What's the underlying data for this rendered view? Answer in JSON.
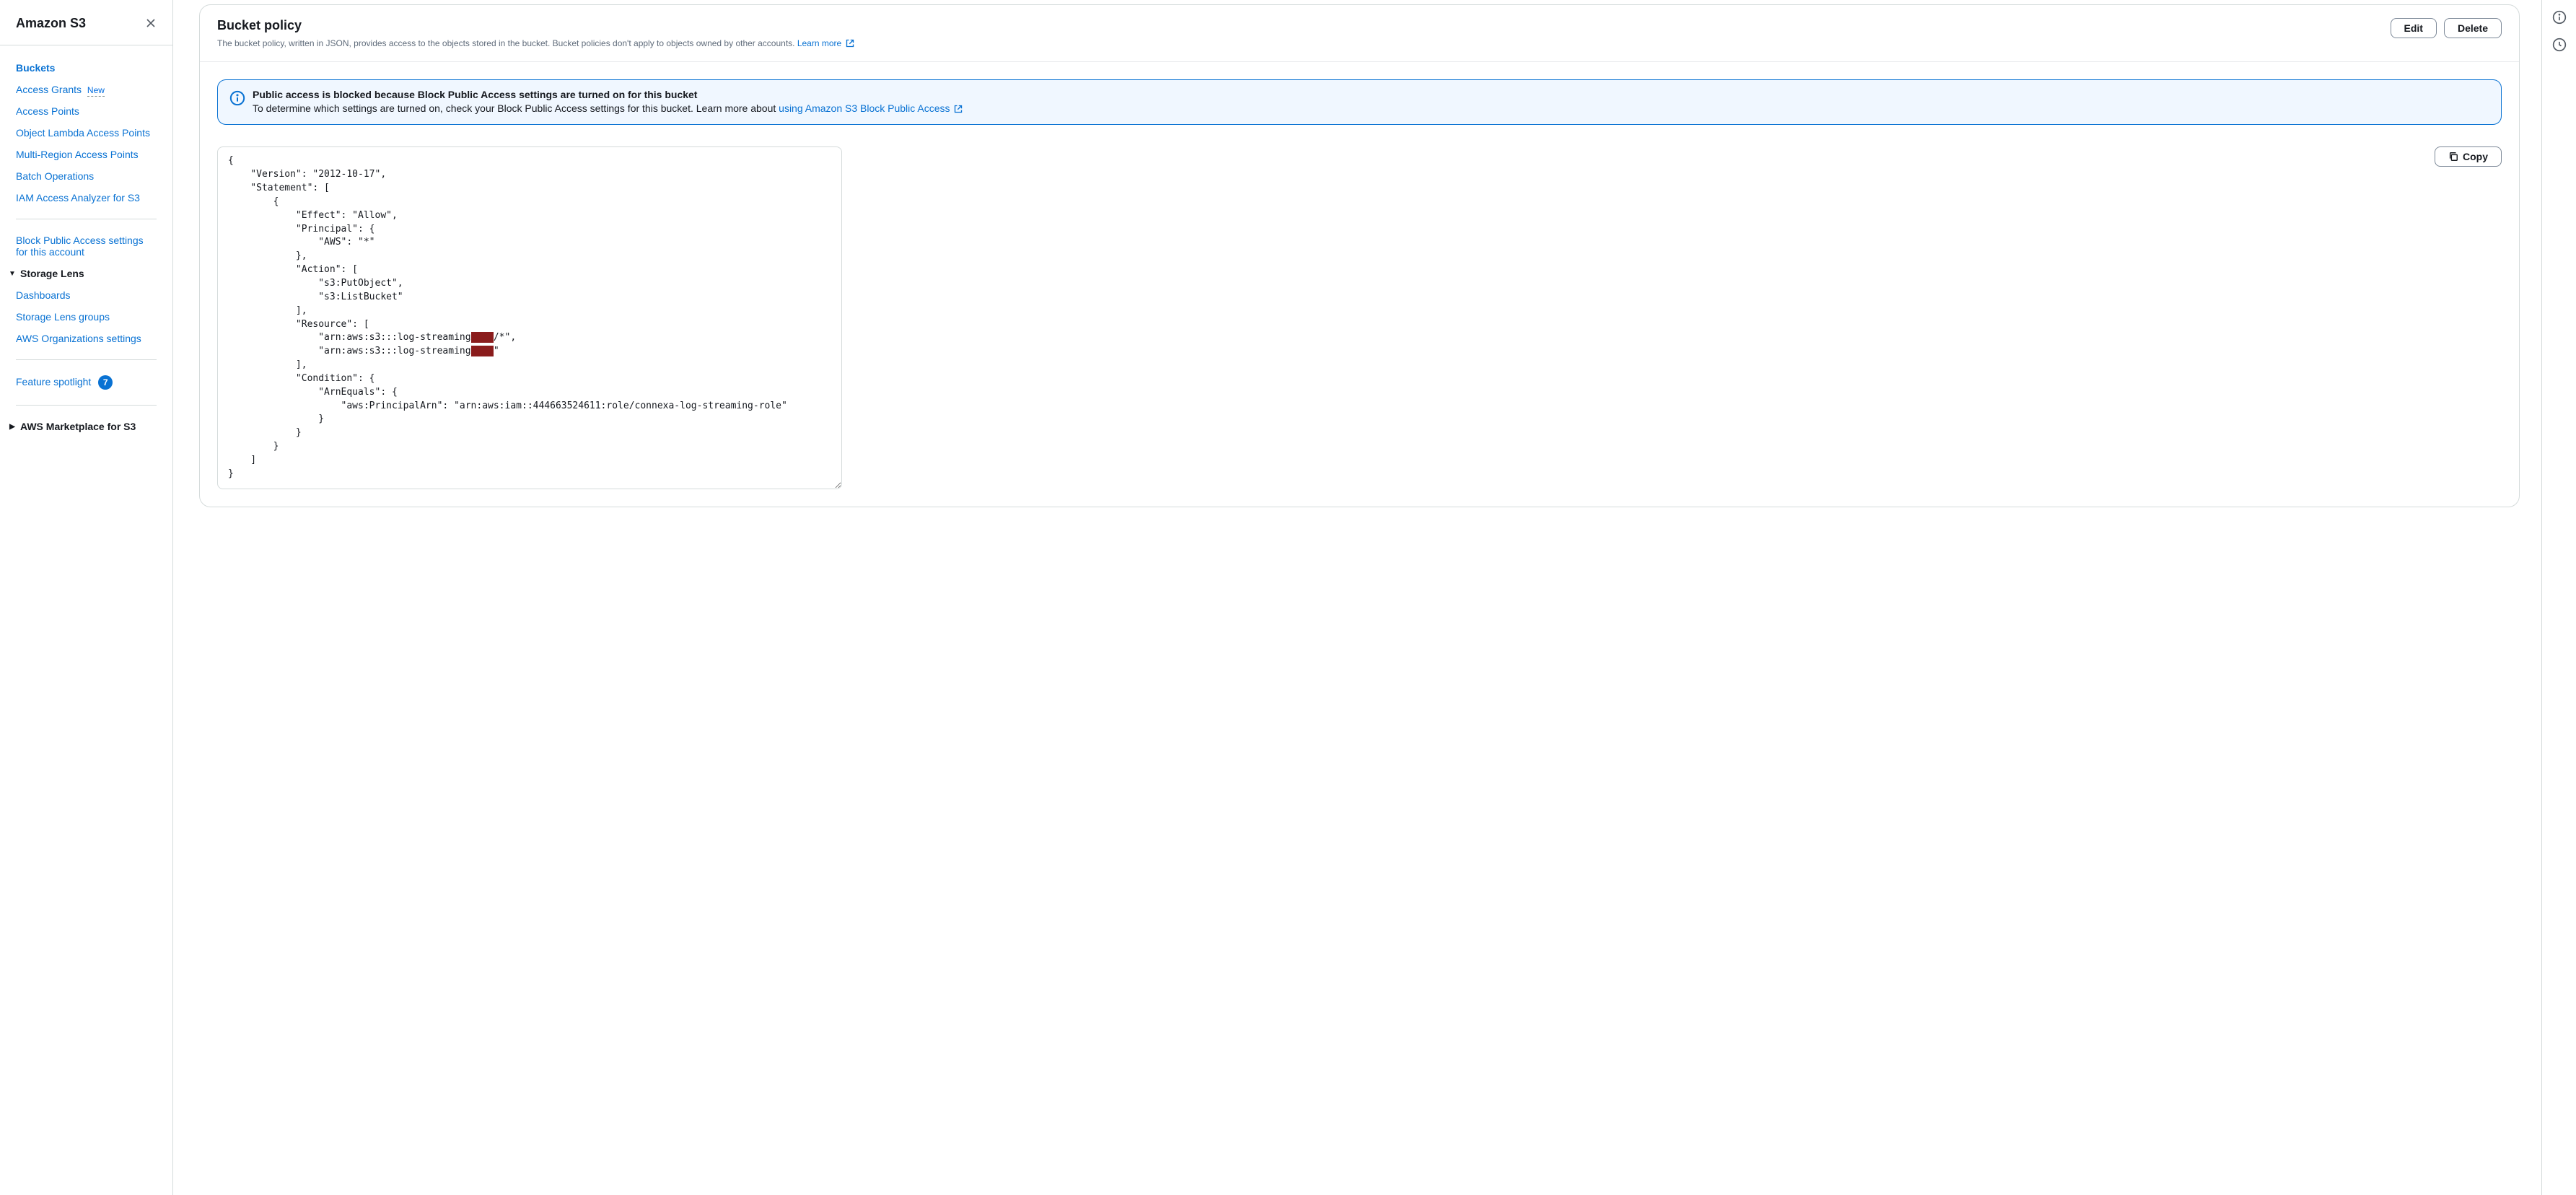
{
  "sidebar": {
    "title": "Amazon S3",
    "items": [
      {
        "label": "Buckets",
        "active": true
      },
      {
        "label": "Access Grants",
        "badge": "New"
      },
      {
        "label": "Access Points"
      },
      {
        "label": "Object Lambda Access Points"
      },
      {
        "label": "Multi-Region Access Points"
      },
      {
        "label": "Batch Operations"
      },
      {
        "label": "IAM Access Analyzer for S3"
      }
    ],
    "block_public": "Block Public Access settings for this account",
    "storage_lens": {
      "header": "Storage Lens",
      "items": [
        {
          "label": "Dashboards"
        },
        {
          "label": "Storage Lens groups"
        },
        {
          "label": "AWS Organizations settings"
        }
      ]
    },
    "feature_spotlight": {
      "label": "Feature spotlight",
      "count": "7"
    },
    "marketplace": "AWS Marketplace for S3"
  },
  "panel": {
    "title": "Bucket policy",
    "description": "The bucket policy, written in JSON, provides access to the objects stored in the bucket. Bucket policies don't apply to objects owned by other accounts. ",
    "learn_more": "Learn more",
    "edit_label": "Edit",
    "delete_label": "Delete",
    "copy_label": "Copy"
  },
  "alert": {
    "title": "Public access is blocked because Block Public Access settings are turned on for this bucket",
    "body_prefix": "To determine which settings are turned on, check your Block Public Access settings for this bucket. Learn more about ",
    "link_text": "using Amazon S3 Block Public Access"
  },
  "policy": {
    "l1": "{",
    "l2": "    \"Version\": \"2012-10-17\",",
    "l3": "    \"Statement\": [",
    "l4": "        {",
    "l5": "            \"Effect\": \"Allow\",",
    "l6": "            \"Principal\": {",
    "l7": "                \"AWS\": \"*\"",
    "l8": "            },",
    "l9": "            \"Action\": [",
    "l10": "                \"s3:PutObject\",",
    "l11": "                \"s3:ListBucket\"",
    "l12": "            ],",
    "l13": "            \"Resource\": [",
    "l14a": "                \"arn:aws:s3:::log-streaming",
    "l14r": "XXXX",
    "l14b": "/*\",",
    "l15a": "                \"arn:aws:s3:::log-streaming",
    "l15r": "XXXX",
    "l15b": "\"",
    "l16": "            ],",
    "l17": "            \"Condition\": {",
    "l18": "                \"ArnEquals\": {",
    "l19": "                    \"aws:PrincipalArn\": \"arn:aws:iam::444663524611:role/connexa-log-streaming-role\"",
    "l20": "                }",
    "l21": "            }",
    "l22": "        }",
    "l23": "    ]",
    "l24": "}"
  }
}
